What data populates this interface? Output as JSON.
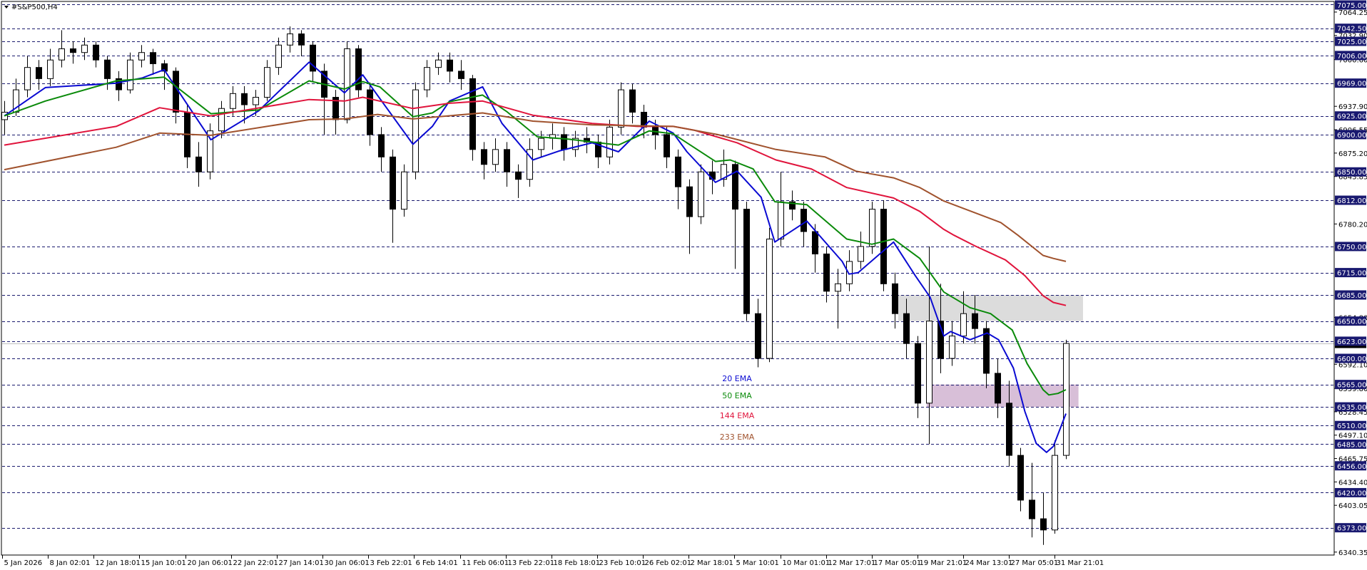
{
  "title": "#S&P500,H4",
  "legend": [
    {
      "label": "20 EMA",
      "color": "#0a0ad2"
    },
    {
      "label": "50 EMA",
      "color": "#0a8a0a"
    },
    {
      "label": "144 EMA",
      "color": "#e0143c"
    },
    {
      "label": "233 EMA",
      "color": "#a0522d"
    }
  ],
  "colors": {
    "grid": "#1a1a6e",
    "level_box": "#191970",
    "bull_body": "#ffffff",
    "bear_body": "#000000",
    "current_price_line": "#c0c0c0"
  },
  "chart_data": {
    "type": "candlestick",
    "symbol": "#S&P500",
    "timeframe": "H4",
    "ylim": [
      6340.35,
      7075.0
    ],
    "x_tick_labels": [
      "5 Jan 2026",
      "8 Jan 02:01",
      "12 Jan 18:01",
      "15 Jan 10:01",
      "20 Jan 06:01",
      "22 Jan 22:01",
      "27 Jan 14:01",
      "30 Jan 06:01",
      "3 Feb 22:01",
      "6 Feb 14:01",
      "11 Feb 06:01",
      "13 Feb 22:01",
      "18 Feb 18:01",
      "23 Feb 10:01",
      "26 Feb 02:01",
      "2 Mar 18:01",
      "5 Mar 10:01",
      "10 Mar 01:01",
      "12 Mar 17:01",
      "17 Mar 05:01",
      "19 Mar 21:01",
      "24 Mar 13:01",
      "27 Mar 05:01",
      "31 Mar 21:01"
    ],
    "y_tick_labels": [
      "7064.25",
      "7032.90",
      "7000.60",
      "6937.90",
      "6906.55",
      "6875.20",
      "6843.85",
      "6780.20",
      "6654.80",
      "6592.10",
      "6559.80",
      "6528.45",
      "6497.10",
      "6465.75",
      "6434.40",
      "6403.05",
      "6340.35"
    ],
    "price_levels": [
      "7075.00",
      "7042.50",
      "7025.00",
      "7006.00",
      "6969.00",
      "6925.00",
      "6900.00",
      "6850.00",
      "6812.00",
      "6750.00",
      "6715.00",
      "6685.00",
      "6650.00",
      "6623.00",
      "6600.00",
      "6565.00",
      "6535.00",
      "6510.00",
      "6485.00",
      "6456.00",
      "6420.00",
      "6373.00"
    ],
    "current_price": 6620,
    "zones": [
      {
        "from": 6650,
        "to": 6685,
        "start_bar": 78.3,
        "end_bar": 94.5,
        "color": "#dcdcdc"
      },
      {
        "from": 6535,
        "to": 6565,
        "start_bar": 80.8,
        "end_bar": 94.1,
        "color": "#d8bfd8"
      }
    ],
    "candles_ohlc": [
      [
        6920,
        6945,
        6900,
        6930
      ],
      [
        6930,
        6975,
        6925,
        6960
      ],
      [
        6960,
        7005,
        6950,
        6990
      ],
      [
        6990,
        7000,
        6960,
        6975
      ],
      [
        6975,
        7015,
        6965,
        7000
      ],
      [
        7000,
        7040,
        6990,
        7015
      ],
      [
        7015,
        7025,
        6995,
        7010
      ],
      [
        7010,
        7030,
        7000,
        7020
      ],
      [
        7020,
        7025,
        6990,
        7000
      ],
      [
        7000,
        7005,
        6960,
        6975
      ],
      [
        6975,
        6985,
        6945,
        6960
      ],
      [
        6960,
        7010,
        6955,
        7000
      ],
      [
        7000,
        7020,
        6990,
        7010
      ],
      [
        7010,
        7015,
        6980,
        6995
      ],
      [
        6995,
        7000,
        6960,
        6985
      ],
      [
        6985,
        6990,
        6915,
        6930
      ],
      [
        6930,
        6940,
        6855,
        6870
      ],
      [
        6870,
        6890,
        6830,
        6850
      ],
      [
        6850,
        6915,
        6840,
        6905
      ],
      [
        6905,
        6945,
        6895,
        6935
      ],
      [
        6935,
        6965,
        6925,
        6955
      ],
      [
        6955,
        6965,
        6915,
        6940
      ],
      [
        6940,
        6960,
        6925,
        6950
      ],
      [
        6950,
        7000,
        6945,
        6990
      ],
      [
        6990,
        7030,
        6980,
        7020
      ],
      [
        7020,
        7045,
        7010,
        7035
      ],
      [
        7035,
        7040,
        7005,
        7020
      ],
      [
        7020,
        7025,
        6970,
        6985
      ],
      [
        6985,
        6995,
        6900,
        6950
      ],
      [
        6950,
        6960,
        6900,
        6920
      ],
      [
        6920,
        7025,
        6915,
        7015
      ],
      [
        7015,
        7020,
        6950,
        6960
      ],
      [
        6960,
        6970,
        6885,
        6900
      ],
      [
        6900,
        6910,
        6850,
        6870
      ],
      [
        6870,
        6880,
        6755,
        6800
      ],
      [
        6800,
        6860,
        6790,
        6850
      ],
      [
        6850,
        6970,
        6840,
        6960
      ],
      [
        6960,
        7000,
        6950,
        6990
      ],
      [
        6990,
        7010,
        6980,
        7000
      ],
      [
        7000,
        7010,
        6970,
        6985
      ],
      [
        6985,
        7000,
        6960,
        6975
      ],
      [
        6975,
        6980,
        6865,
        6880
      ],
      [
        6880,
        6890,
        6840,
        6860
      ],
      [
        6860,
        6895,
        6850,
        6880
      ],
      [
        6880,
        6890,
        6830,
        6850
      ],
      [
        6850,
        6860,
        6815,
        6840
      ],
      [
        6840,
        6895,
        6830,
        6880
      ],
      [
        6880,
        6905,
        6870,
        6895
      ],
      [
        6895,
        6915,
        6880,
        6900
      ],
      [
        6900,
        6910,
        6865,
        6880
      ],
      [
        6880,
        6905,
        6870,
        6895
      ],
      [
        6895,
        6910,
        6875,
        6890
      ],
      [
        6890,
        6900,
        6855,
        6870
      ],
      [
        6870,
        6920,
        6860,
        6910
      ],
      [
        6910,
        6970,
        6900,
        6960
      ],
      [
        6960,
        6968,
        6915,
        6930
      ],
      [
        6930,
        6940,
        6895,
        6910
      ],
      [
        6910,
        6920,
        6880,
        6900
      ],
      [
        6900,
        6910,
        6855,
        6870
      ],
      [
        6870,
        6880,
        6800,
        6830
      ],
      [
        6830,
        6840,
        6740,
        6790
      ],
      [
        6790,
        6860,
        6780,
        6850
      ],
      [
        6850,
        6865,
        6820,
        6840
      ],
      [
        6840,
        6880,
        6830,
        6860
      ],
      [
        6860,
        6865,
        6720,
        6800
      ],
      [
        6800,
        6810,
        6650,
        6660
      ],
      [
        6660,
        6680,
        6588,
        6600
      ],
      [
        6600,
        6775,
        6595,
        6760
      ],
      [
        6760,
        6850,
        6750,
        6810
      ],
      [
        6810,
        6825,
        6785,
        6800
      ],
      [
        6800,
        6810,
        6750,
        6770
      ],
      [
        6770,
        6780,
        6715,
        6740
      ],
      [
        6740,
        6750,
        6675,
        6690
      ],
      [
        6690,
        6720,
        6640,
        6700
      ],
      [
        6700,
        6745,
        6690,
        6730
      ],
      [
        6730,
        6770,
        6720,
        6750
      ],
      [
        6750,
        6810,
        6740,
        6800
      ],
      [
        6800,
        6812,
        6690,
        6700
      ],
      [
        6700,
        6715,
        6640,
        6660
      ],
      [
        6660,
        6680,
        6600,
        6620
      ],
      [
        6620,
        6630,
        6520,
        6540
      ],
      [
        6540,
        6750,
        6485,
        6650
      ],
      [
        6650,
        6700,
        6580,
        6600
      ],
      [
        6600,
        6650,
        6590,
        6630
      ],
      [
        6630,
        6690,
        6620,
        6660
      ],
      [
        6660,
        6685,
        6620,
        6640
      ],
      [
        6640,
        6650,
        6560,
        6580
      ],
      [
        6580,
        6600,
        6520,
        6540
      ],
      [
        6540,
        6570,
        6455,
        6470
      ],
      [
        6470,
        6480,
        6395,
        6410
      ],
      [
        6410,
        6460,
        6360,
        6385
      ],
      [
        6385,
        6420,
        6350,
        6370
      ],
      [
        6370,
        6490,
        6365,
        6470
      ],
      [
        6470,
        6625,
        6465,
        6620
      ]
    ],
    "ema_series": [
      {
        "name": "20 EMA",
        "color": "#0a0ad2",
        "points": [
          [
            0,
            6925
          ],
          [
            3.6,
            6963
          ],
          [
            9.8,
            6969
          ],
          [
            12.1,
            6976
          ],
          [
            14,
            6987
          ],
          [
            18.1,
            6893
          ],
          [
            22.3,
            6932
          ],
          [
            26.7,
            6997
          ],
          [
            29.8,
            6956
          ],
          [
            31.4,
            6980
          ],
          [
            35.8,
            6887
          ],
          [
            37.5,
            6911
          ],
          [
            39,
            6945
          ],
          [
            41.9,
            6964
          ],
          [
            43.6,
            6915
          ],
          [
            46.3,
            6866
          ],
          [
            48.6,
            6878
          ],
          [
            51.5,
            6889
          ],
          [
            53.8,
            6877
          ],
          [
            56.5,
            6918
          ],
          [
            58.6,
            6902
          ],
          [
            59.8,
            6877
          ],
          [
            62.3,
            6836
          ],
          [
            64.2,
            6851
          ],
          [
            66.3,
            6816
          ],
          [
            67.5,
            6756
          ],
          [
            70.3,
            6784
          ],
          [
            73.4,
            6730
          ],
          [
            74,
            6713
          ],
          [
            74.8,
            6715
          ],
          [
            77.9,
            6756
          ],
          [
            79.8,
            6711
          ],
          [
            81.1,
            6682
          ],
          [
            82.3,
            6630
          ],
          [
            82.9,
            6636
          ],
          [
            84.6,
            6625
          ],
          [
            86.1,
            6634
          ],
          [
            87.1,
            6625
          ],
          [
            88.4,
            6587
          ],
          [
            89.4,
            6529
          ],
          [
            90.4,
            6486
          ],
          [
            91.3,
            6474
          ],
          [
            91.9,
            6482
          ],
          [
            93,
            6526
          ]
        ]
      },
      {
        "name": "50 EMA",
        "color": "#0a8a0a",
        "points": [
          [
            0,
            6925
          ],
          [
            3.6,
            6945
          ],
          [
            9.8,
            6972
          ],
          [
            14,
            6977
          ],
          [
            18.1,
            6928
          ],
          [
            22.3,
            6933
          ],
          [
            26.7,
            6972
          ],
          [
            29.8,
            6961
          ],
          [
            31.4,
            6971
          ],
          [
            32.9,
            6964
          ],
          [
            35.8,
            6924
          ],
          [
            37.5,
            6929
          ],
          [
            39,
            6944
          ],
          [
            41.9,
            6953
          ],
          [
            44,
            6931
          ],
          [
            46.7,
            6897
          ],
          [
            49.4,
            6894
          ],
          [
            53.8,
            6886
          ],
          [
            56.5,
            6905
          ],
          [
            58.6,
            6901
          ],
          [
            59.8,
            6889
          ],
          [
            62.3,
            6864
          ],
          [
            63.6,
            6866
          ],
          [
            65.6,
            6854
          ],
          [
            67.5,
            6810
          ],
          [
            70.3,
            6806
          ],
          [
            73.8,
            6760
          ],
          [
            76,
            6753
          ],
          [
            77.9,
            6760
          ],
          [
            80.2,
            6734
          ],
          [
            82.3,
            6689
          ],
          [
            84.6,
            6668
          ],
          [
            86.4,
            6660
          ],
          [
            88.3,
            6638
          ],
          [
            89.6,
            6593
          ],
          [
            91,
            6558
          ],
          [
            91.5,
            6551
          ],
          [
            92.3,
            6553
          ],
          [
            93,
            6558
          ]
        ]
      },
      {
        "name": "144 EMA",
        "color": "#e0143c",
        "points": [
          [
            0,
            6886
          ],
          [
            9.8,
            6911
          ],
          [
            13.6,
            6936
          ],
          [
            18.1,
            6925
          ],
          [
            26.7,
            6947
          ],
          [
            29.8,
            6945
          ],
          [
            31.4,
            6950
          ],
          [
            35.8,
            6935
          ],
          [
            39,
            6942
          ],
          [
            41.9,
            6945
          ],
          [
            46.3,
            6926
          ],
          [
            51.5,
            6915
          ],
          [
            55.5,
            6911
          ],
          [
            58.6,
            6911
          ],
          [
            60.4,
            6906
          ],
          [
            64.2,
            6889
          ],
          [
            67.6,
            6866
          ],
          [
            70.7,
            6854
          ],
          [
            73.8,
            6829
          ],
          [
            77.9,
            6815
          ],
          [
            80.2,
            6797
          ],
          [
            82.3,
            6773
          ],
          [
            83.2,
            6765
          ],
          [
            85,
            6751
          ],
          [
            87.7,
            6732
          ],
          [
            89.4,
            6711
          ],
          [
            91,
            6684
          ],
          [
            91.9,
            6675
          ],
          [
            93,
            6671
          ]
        ]
      },
      {
        "name": "233 EMA",
        "color": "#a0522d",
        "points": [
          [
            0,
            6853
          ],
          [
            9.8,
            6883
          ],
          [
            13.6,
            6902
          ],
          [
            18.1,
            6899
          ],
          [
            26.7,
            6920
          ],
          [
            29.8,
            6921
          ],
          [
            32.7,
            6927
          ],
          [
            35.8,
            6921
          ],
          [
            41.9,
            6929
          ],
          [
            46.3,
            6918
          ],
          [
            51.5,
            6913
          ],
          [
            58.6,
            6911
          ],
          [
            62.5,
            6900
          ],
          [
            67.6,
            6880
          ],
          [
            71.9,
            6870
          ],
          [
            74.6,
            6851
          ],
          [
            77.9,
            6842
          ],
          [
            80.2,
            6829
          ],
          [
            82.3,
            6811
          ],
          [
            87.3,
            6782
          ],
          [
            88.8,
            6765
          ],
          [
            91,
            6738
          ],
          [
            91.9,
            6734
          ],
          [
            93,
            6730
          ]
        ]
      }
    ]
  }
}
